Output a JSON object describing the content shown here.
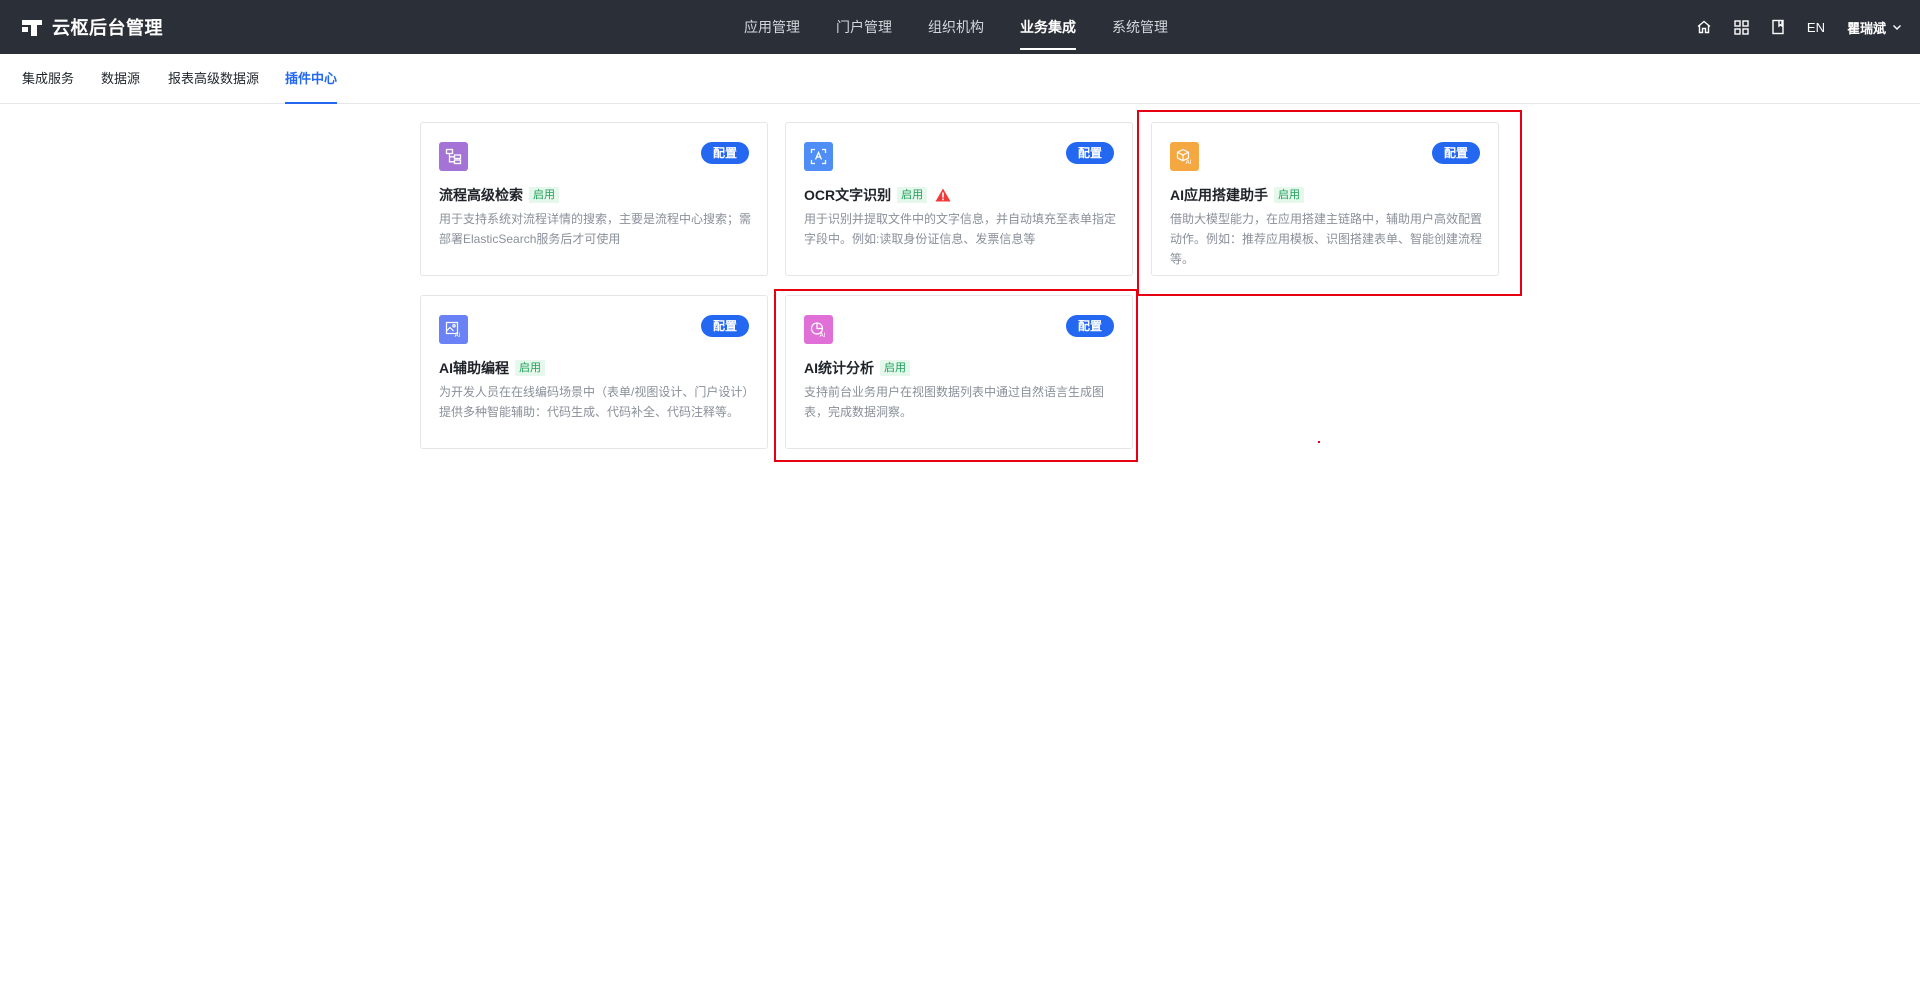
{
  "header": {
    "app_title": "云枢后台管理",
    "nav": [
      {
        "label": "应用管理",
        "active": false
      },
      {
        "label": "门户管理",
        "active": false
      },
      {
        "label": "组织机构",
        "active": false
      },
      {
        "label": "业务集成",
        "active": true
      },
      {
        "label": "系统管理",
        "active": false
      }
    ],
    "tools": {
      "home_icon": "home-icon",
      "apps_icon": "grid-icon",
      "docs_icon": "book-icon",
      "language": "EN",
      "user_name": "瞿瑞斌",
      "user_menu_icon": "chevron-down-icon"
    }
  },
  "subtabs": [
    {
      "label": "集成服务",
      "active": false
    },
    {
      "label": "数据源",
      "active": false
    },
    {
      "label": "报表高级数据源",
      "active": false
    },
    {
      "label": "插件中心",
      "active": true
    }
  ],
  "cards": [
    {
      "icon": "flow-search-icon",
      "icon_color": "#a573d6",
      "title": "流程高级检索",
      "badge": "启用",
      "button": "配置",
      "description": "用于支持系统对流程详情的搜索，主要是流程中心搜索；需部署ElasticSearch服务后才可使用"
    },
    {
      "icon": "ocr-scan-icon",
      "icon_color": "#4f8ef7",
      "title": "OCR文字识别",
      "badge": "启用",
      "warning": true,
      "warning_icon": "warning-icon",
      "button": "配置",
      "description": "用于识别并提取文件中的文字信息，并自动填充至表单指定字段中。例如:读取身份证信息、发票信息等"
    },
    {
      "icon": "ai-cube-icon",
      "icon_color": "#f5a742",
      "title": "AI应用搭建助手",
      "badge": "启用",
      "button": "配置",
      "description": "借助大模型能力，在应用搭建主链路中，辅助用户高效配置动作。例如：推荐应用模板、识图搭建表单、智能创建流程等。"
    },
    {
      "icon": "ai-image-code-icon",
      "icon_color": "#6a82f5",
      "title": "AI辅助编程",
      "badge": "启用",
      "button": "配置",
      "description": "为开发人员在在线编码场景中（表单/视图设计、门户设计）提供多种智能辅助：代码生成、代码补全、代码注释等。"
    },
    {
      "icon": "ai-chart-icon",
      "icon_color": "#e070d8",
      "title": "AI统计分析",
      "badge": "启用",
      "button": "配置",
      "description": "支持前台业务用户在视图数据列表中通过自然语言生成图表，完成数据洞察。"
    }
  ],
  "colors": {
    "header_bg": "#2b3038",
    "accent": "#2468f2",
    "badge_green": "#1fa05a",
    "highlight_red": "#e60012"
  }
}
